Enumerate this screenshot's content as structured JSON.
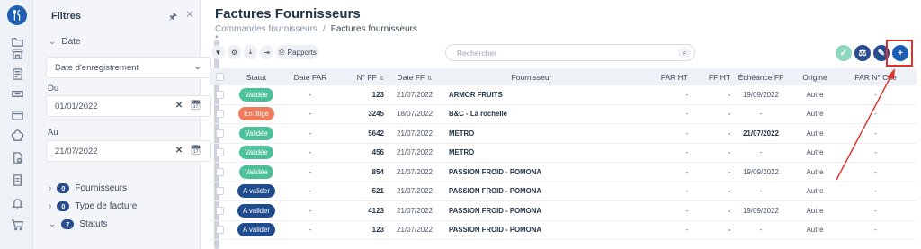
{
  "rail": {
    "icons": [
      "logo-icon",
      "folder-icon",
      "store-icon",
      "receipt-icon",
      "badge-icon",
      "box-icon",
      "chef-hat-icon",
      "document-icon",
      "invoice-icon",
      "bell-icon",
      "cart-icon"
    ]
  },
  "filters": {
    "title": "Filtres",
    "date_section": "Date",
    "date_type": "Date d'enregistrement",
    "from_label": "Du",
    "from_value": "01/01/2022",
    "to_label": "Au",
    "to_value": "21/07/2022",
    "groups": [
      {
        "label": "Fournisseurs",
        "count": "0"
      },
      {
        "label": "Type de facture",
        "count": "0"
      },
      {
        "label": "Statuts",
        "count": "7"
      }
    ]
  },
  "header": {
    "title": "Factures Fournisseurs",
    "breadcrumb_parent": "Commandes fournisseurs",
    "breadcrumb_sep": "/",
    "breadcrumb_current": "Factures fournisseurs"
  },
  "toolbar": {
    "reports_label": "Rapports",
    "search_placeholder": "Rechercher"
  },
  "colors": {
    "validated": "#4dc09b",
    "dispute": "#f07b5b",
    "to_validate": "#1f4c8f",
    "accent": "#1e5fb3",
    "highlight": "#e0302b"
  },
  "table": {
    "columns": [
      "Statut",
      "Date FAR",
      "N° FF",
      "Date FF",
      "Fournisseur",
      "FAR HT",
      "FF HT",
      "Échéance FF",
      "Origine",
      "FAR N° Cde"
    ],
    "rows": [
      {
        "status": "Validée",
        "kind": "validated",
        "date_far": "-",
        "nff": "123",
        "date_ff": "21/07/2022",
        "supplier": "ARMOR FRUITS",
        "far_ht": "-",
        "ff_ht": "-",
        "echeance": "19/09/2022",
        "ech_bold": false,
        "origin": "Autre",
        "far_cde": "-"
      },
      {
        "status": "En litige",
        "kind": "dispute",
        "date_far": "-",
        "nff": "3245",
        "date_ff": "18/07/2022",
        "supplier": "B&C - La rochelle",
        "far_ht": "-",
        "ff_ht": "-",
        "echeance": "-",
        "ech_bold": false,
        "origin": "Autre",
        "far_cde": "-"
      },
      {
        "status": "Validée",
        "kind": "validated",
        "date_far": "-",
        "nff": "5642",
        "date_ff": "21/07/2022",
        "supplier": "METRO",
        "far_ht": "-",
        "ff_ht": "-",
        "echeance": "21/07/2022",
        "ech_bold": true,
        "origin": "Autre",
        "far_cde": "-"
      },
      {
        "status": "Validée",
        "kind": "validated",
        "date_far": "-",
        "nff": "456",
        "date_ff": "21/07/2022",
        "supplier": "METRO",
        "far_ht": "-",
        "ff_ht": "-",
        "echeance": "-",
        "ech_bold": false,
        "origin": "Autre",
        "far_cde": "-"
      },
      {
        "status": "Validée",
        "kind": "validated",
        "date_far": "-",
        "nff": "854",
        "date_ff": "21/07/2022",
        "supplier": "PASSION FROID - POMONA",
        "far_ht": "-",
        "ff_ht": "-",
        "echeance": "19/09/2022",
        "ech_bold": false,
        "origin": "Autre",
        "far_cde": "-"
      },
      {
        "status": "A valider",
        "kind": "to_validate",
        "date_far": "-",
        "nff": "521",
        "date_ff": "21/07/2022",
        "supplier": "PASSION FROID - POMONA",
        "far_ht": "-",
        "ff_ht": "-",
        "echeance": "-",
        "ech_bold": false,
        "origin": "Autre",
        "far_cde": "-"
      },
      {
        "status": "A valider",
        "kind": "to_validate",
        "date_far": "-",
        "nff": "4123",
        "date_ff": "21/07/2022",
        "supplier": "PASSION FROID - POMONA",
        "far_ht": "-",
        "ff_ht": "-",
        "echeance": "19/09/2022",
        "ech_bold": false,
        "origin": "Autre",
        "far_cde": "-"
      },
      {
        "status": "A valider",
        "kind": "to_validate",
        "date_far": "-",
        "nff": "123",
        "date_ff": "21/07/2022",
        "supplier": "PASSION FROID - POMONA",
        "far_ht": "-",
        "ff_ht": "-",
        "echeance": "-",
        "ech_bold": false,
        "origin": "Autre",
        "far_cde": "-"
      }
    ]
  }
}
